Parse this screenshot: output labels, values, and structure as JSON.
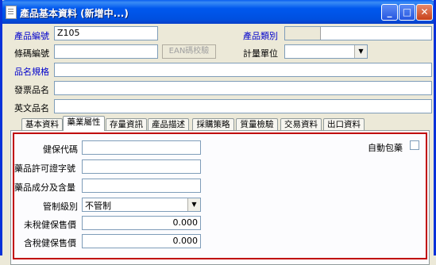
{
  "window": {
    "title": "產品基本資料 (新增中...)"
  },
  "header_fields": {
    "product_code": {
      "label": "產品編號",
      "value": "Z105"
    },
    "product_category": {
      "label": "產品類別",
      "value": ""
    },
    "barcode": {
      "label": "條碼編號",
      "value": ""
    },
    "ean_button": "EAN碼校驗",
    "unit": {
      "label": "計量單位",
      "value": ""
    },
    "spec": {
      "label": "品名規格",
      "value": ""
    },
    "invoice_name": {
      "label": "發票品名",
      "value": ""
    },
    "english_name": {
      "label": "英文品名",
      "value": ""
    }
  },
  "tabs": [
    {
      "label": "基本資料",
      "active": false
    },
    {
      "label": "藥業屬性",
      "active": true
    },
    {
      "label": "存量資訊",
      "active": false
    },
    {
      "label": "產品描述",
      "active": false
    },
    {
      "label": "採購策略",
      "active": false
    },
    {
      "label": "質量檢驗",
      "active": false
    },
    {
      "label": "交易資料",
      "active": false
    },
    {
      "label": "出口資料",
      "active": false
    }
  ],
  "pharma": {
    "insurance_code": {
      "label": "健保代碼",
      "value": ""
    },
    "license_no": {
      "label": "藥品許可證字號",
      "value": ""
    },
    "ingredients": {
      "label": "藥品成分及含量",
      "value": ""
    },
    "control_level": {
      "label": "管制級別",
      "value": "不管制"
    },
    "price_pretax": {
      "label": "未稅健保售價",
      "value": "0.000"
    },
    "price_tax": {
      "label": "含稅健保售價",
      "value": "0.000"
    },
    "auto_pack": {
      "label": "自動包藥",
      "checked": false
    }
  }
}
